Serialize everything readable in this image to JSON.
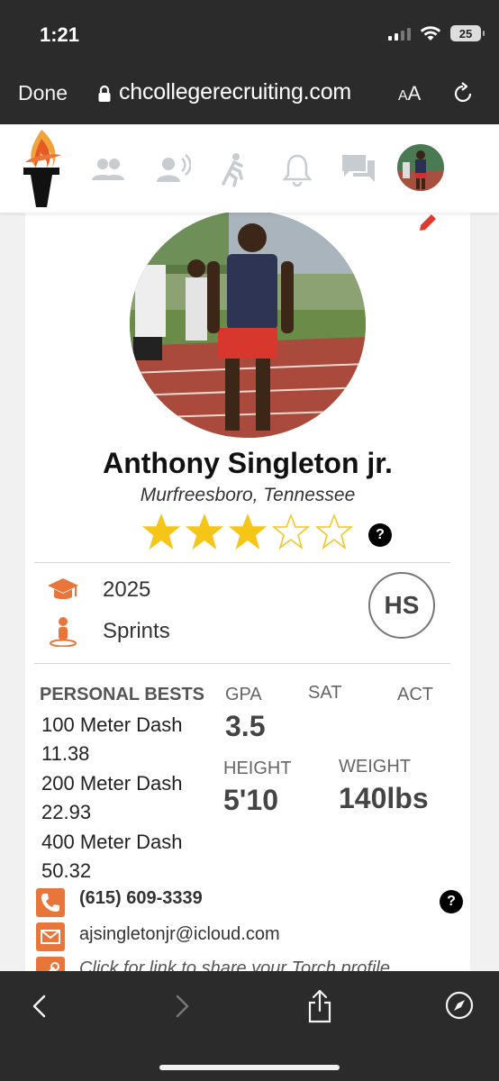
{
  "status_bar": {
    "time": "1:21",
    "battery": "25"
  },
  "browser": {
    "done_label": "Done",
    "url": "chcollegerecruiting.com",
    "text_size_label": "AA"
  },
  "nav": {
    "items": [
      "people-icon",
      "recruit-voice-icon",
      "athlete-run-icon",
      "bell-icon",
      "chat-icon"
    ]
  },
  "profile": {
    "name": "Anthony Singleton jr.",
    "location": "Murfreesboro, Tennessee",
    "rating": 3,
    "rating_max": 5,
    "help_symbol": "?",
    "grad_year": "2025",
    "event": "Sprints",
    "level_badge": "HS",
    "accent_color": "#e8763a",
    "star_color": "#f5c518"
  },
  "personal_bests": {
    "heading": "PERSONAL BESTS",
    "events": [
      {
        "event": "100 Meter Dash",
        "mark": "11.38"
      },
      {
        "event": "200 Meter Dash",
        "mark": "22.93"
      },
      {
        "event": "400 Meter Dash",
        "mark": "50.32"
      }
    ]
  },
  "stats": {
    "gpa_label": "GPA",
    "gpa_value": "3.5",
    "sat_label": "SAT",
    "act_label": "ACT",
    "height_label": "HEIGHT",
    "height_value": "5'10",
    "weight_label": "WEIGHT",
    "weight_value": "140lbs"
  },
  "contact": {
    "phone": "(615) 609-3339",
    "email": "ajsingletonjr@icloud.com",
    "share_text": "Click for link to share your Torch profile"
  }
}
